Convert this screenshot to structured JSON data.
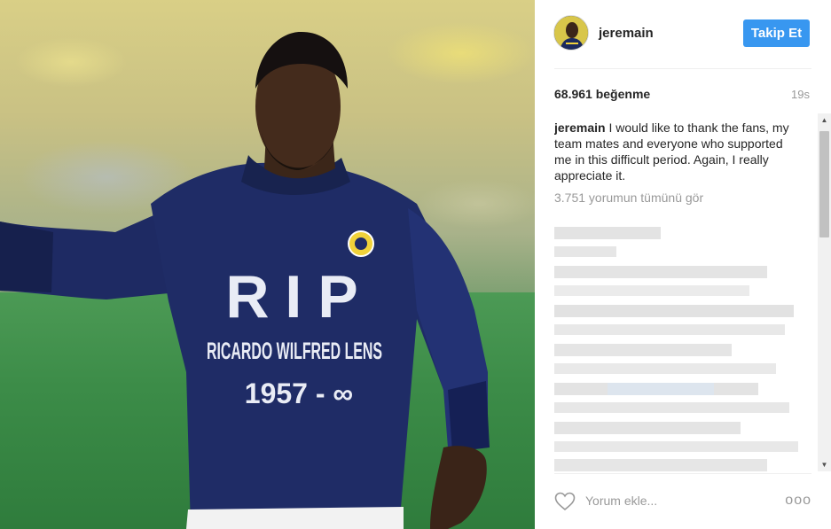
{
  "post": {
    "shirt_text": {
      "line1": "RIP",
      "line2": "RICARDO WILFRED LENS",
      "line3": "1957 - ∞"
    }
  },
  "header": {
    "username": "jeremain",
    "follow_label": "Takip Et"
  },
  "stats": {
    "likes": "68.961 beğenme",
    "time": "19s"
  },
  "caption": {
    "username": "jeremain",
    "text": "I would like to thank the fans, my team mates and everyone who supported me in this difficult period. Again, I really appreciate it."
  },
  "comments": {
    "view_all": "3.751 yorumun tümünü gör"
  },
  "footer": {
    "add_comment_placeholder": "Yorum ekle...",
    "more_label": "ooo"
  },
  "colors": {
    "follow_button": "#3897f0",
    "shirt": "#1e2a63"
  },
  "icons": [
    "heart-icon",
    "more-options-icon",
    "scroll-up-icon",
    "scroll-down-icon"
  ]
}
